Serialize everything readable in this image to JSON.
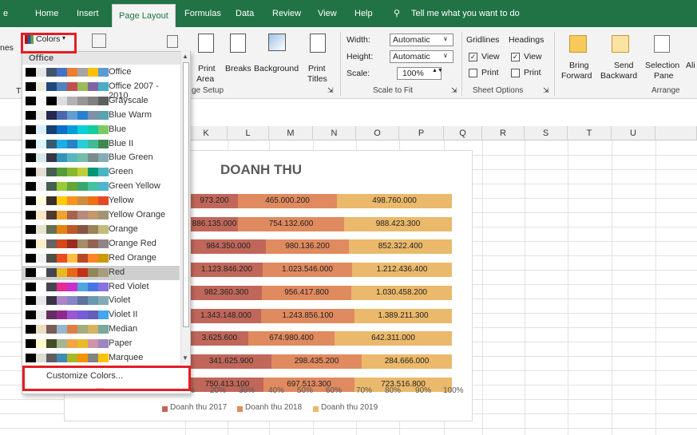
{
  "tabs": [
    {
      "label": "e"
    },
    {
      "label": "Home"
    },
    {
      "label": "Insert"
    },
    {
      "label": "Page Layout"
    },
    {
      "label": "Formulas"
    },
    {
      "label": "Data"
    },
    {
      "label": "Review"
    },
    {
      "label": "View"
    },
    {
      "label": "Help"
    }
  ],
  "tellme": "Tell me what you want to do",
  "ribbon": {
    "colors": "Colors",
    "print_area_1": "Print",
    "print_area_2": "Area",
    "breaks": "Breaks",
    "background": "Background",
    "print_titles_1": "Print",
    "print_titles_2": "Titles",
    "page_setup": "ge Setup",
    "width_label": "Width:",
    "width_value": "Automatic",
    "height_label": "Height:",
    "height_value": "Automatic",
    "scale_label": "Scale:",
    "scale_value": "100%",
    "scale_to_fit": "Scale to Fit",
    "gridlines": "Gridlines",
    "headings": "Headings",
    "view1": "View",
    "view2": "View",
    "print1": "Print",
    "print2": "Print",
    "sheet_options": "Sheet Options",
    "bring_forward_1": "Bring",
    "bring_forward_2": "Forward",
    "send_backward_1": "Send",
    "send_backward_2": "Backward",
    "selection_pane_1": "Selection",
    "selection_pane_2": "Pane",
    "align": "Ali",
    "arrange": "Arrange",
    "themes_partial": "nes",
    "t_partial": "T"
  },
  "columns": [
    "K",
    "L",
    "M",
    "N",
    "O",
    "P",
    "Q",
    "R",
    "S",
    "T",
    "U"
  ],
  "dropdown": {
    "section": "Office",
    "customize": "Customize Colors...",
    "dots": "....",
    "items": [
      {
        "label": "Office",
        "colors": [
          "#000000",
          "#e7e6e6",
          "#44546a",
          "#4472c4",
          "#ed7d31",
          "#a5a5a5",
          "#ffc000",
          "#5b9bd5"
        ]
      },
      {
        "label": "Office 2007 - 2010",
        "colors": [
          "#000000",
          "#eeece1",
          "#1f497d",
          "#4f81bd",
          "#c0504d",
          "#9bbb59",
          "#8064a2",
          "#4bacc6"
        ]
      },
      {
        "label": "Grayscale",
        "colors": [
          "#000000",
          "#f8f8f8",
          "#000000",
          "#dddddd",
          "#b2b2b2",
          "#969696",
          "#808080",
          "#5f5f5f"
        ]
      },
      {
        "label": "Blue Warm",
        "colors": [
          "#000000",
          "#ebebeb",
          "#242852",
          "#4a66ac",
          "#629dd1",
          "#297fd5",
          "#7f8fa9",
          "#5aa2ae"
        ]
      },
      {
        "label": "Blue",
        "colors": [
          "#000000",
          "#dbeff9",
          "#17406d",
          "#0f6fc6",
          "#009dd9",
          "#0bd0d9",
          "#10cf9b",
          "#7cca62"
        ]
      },
      {
        "label": "Blue II",
        "colors": [
          "#000000",
          "#dbf5f9",
          "#335b74",
          "#1cade4",
          "#2683c6",
          "#27ced7",
          "#42ba97",
          "#3e8853"
        ]
      },
      {
        "label": "Blue Green",
        "colors": [
          "#000000",
          "#d6e8e8",
          "#373545",
          "#3494ba",
          "#58b6c0",
          "#75bda7",
          "#7a8c8e",
          "#84acb6"
        ]
      },
      {
        "label": "Green",
        "colors": [
          "#000000",
          "#e3ded1",
          "#455f51",
          "#549e39",
          "#8ab833",
          "#c0cf3a",
          "#029676",
          "#4ab5c4"
        ]
      },
      {
        "label": "Green Yellow",
        "colors": [
          "#000000",
          "#f2f2f2",
          "#455f51",
          "#99cb38",
          "#63a537",
          "#37a76f",
          "#44c1a3",
          "#4eb3cf"
        ]
      },
      {
        "label": "Yellow",
        "colors": [
          "#000000",
          "#fffedd",
          "#39302a",
          "#ffca08",
          "#f8931d",
          "#ce8d3e",
          "#ec7016",
          "#e64823"
        ]
      },
      {
        "label": "Yellow Orange",
        "colors": [
          "#000000",
          "#fbe7c6",
          "#4e3b30",
          "#f0a22e",
          "#a5644e",
          "#b58b80",
          "#c3986d",
          "#a19574"
        ]
      },
      {
        "label": "Orange",
        "colors": [
          "#000000",
          "#e8e3d1",
          "#637052",
          "#e48312",
          "#bd582c",
          "#865640",
          "#9b8357",
          "#c2bc80"
        ]
      },
      {
        "label": "Orange Red",
        "colors": [
          "#000000",
          "#fbeec9",
          "#696464",
          "#d34817",
          "#9b2d1f",
          "#a28e6a",
          "#956251",
          "#918485"
        ]
      },
      {
        "label": "Red Orange",
        "colors": [
          "#000000",
          "#f2f2f2",
          "#505046",
          "#e84c22",
          "#ffbd47",
          "#b64926",
          "#ff8427",
          "#cc9900"
        ]
      },
      {
        "label": "Red",
        "colors": [
          "#000000",
          "#ffffff",
          "#454551",
          "#e6b91e",
          "#e76618",
          "#c42f1a",
          "#918655",
          "#a79c80"
        ]
      },
      {
        "label": "Red Violet",
        "colors": [
          "#000000",
          "#eeececd",
          "#454551",
          "#e32d91",
          "#c830cc",
          "#4ea6dc",
          "#4775e7",
          "#8971e1"
        ]
      },
      {
        "label": "Violet",
        "colors": [
          "#000000",
          "#e7e6e6",
          "#373545",
          "#ad84c6",
          "#8784c7",
          "#5d739a",
          "#6997af",
          "#84acb6"
        ]
      },
      {
        "label": "Violet II",
        "colors": [
          "#000000",
          "#ebebeb",
          "#632e62",
          "#92278f",
          "#9b57d3",
          "#755dd9",
          "#665eb8",
          "#45a5ed"
        ]
      },
      {
        "label": "Median",
        "colors": [
          "#000000",
          "#ebddc3",
          "#775f55",
          "#94b6d2",
          "#dd8047",
          "#a5ab81",
          "#d8b25c",
          "#7ba79d"
        ]
      },
      {
        "label": "Paper",
        "colors": [
          "#000000",
          "#fefac9",
          "#444d26",
          "#a5b592",
          "#f3a447",
          "#e7bc29",
          "#d092a7",
          "#9c85c0"
        ]
      },
      {
        "label": "Marquee",
        "colors": [
          "#000000",
          "#ddddd0",
          "#5e5e5e",
          "#418ab3",
          "#a6b727",
          "#f69200",
          "#838383",
          "#fec306"
        ]
      }
    ]
  },
  "chart_data": {
    "type": "bar",
    "title": "DOANH THU",
    "stacked": "100%",
    "xticks": [
      "%",
      "20%",
      "30%",
      "40%",
      "50%",
      "60%",
      "70%",
      "80%",
      "90%",
      "100%"
    ],
    "series": [
      {
        "name": "Doanh thu 2017",
        "color": "#c0675a",
        "values": [
          "973.200",
          "886.135.000",
          "984.350.000",
          "1.123.846.200",
          "982.360.300",
          "1.343.148.000",
          "3.625.600",
          "341.625.900",
          "750.413.100"
        ]
      },
      {
        "name": "Doanh thu 2018",
        "color": "#e08a5f",
        "values": [
          "465.000.200",
          "754.132.600",
          "980.136.200",
          "1.023.546.000",
          "956.417.800",
          "1.243.856.100",
          "674.980.400",
          "298.435.200",
          "697.513.300"
        ]
      },
      {
        "name": "Doanh thu 2019",
        "color": "#ebb96b",
        "values": [
          "498.760.000",
          "988.423.300",
          "852.322.400",
          "1.212.436.400",
          "1.030.458.200",
          "1.389.211.300",
          "642.311.000",
          "284.666.000",
          "723.516.800"
        ]
      }
    ],
    "label_text": [
      "973.200",
      "886.135.000",
      "984.350.000",
      "1.123.846.200",
      "982.360.300",
      "1.343.148.000",
      "3.625.600",
      "341.625.900",
      "750.413.100"
    ]
  }
}
